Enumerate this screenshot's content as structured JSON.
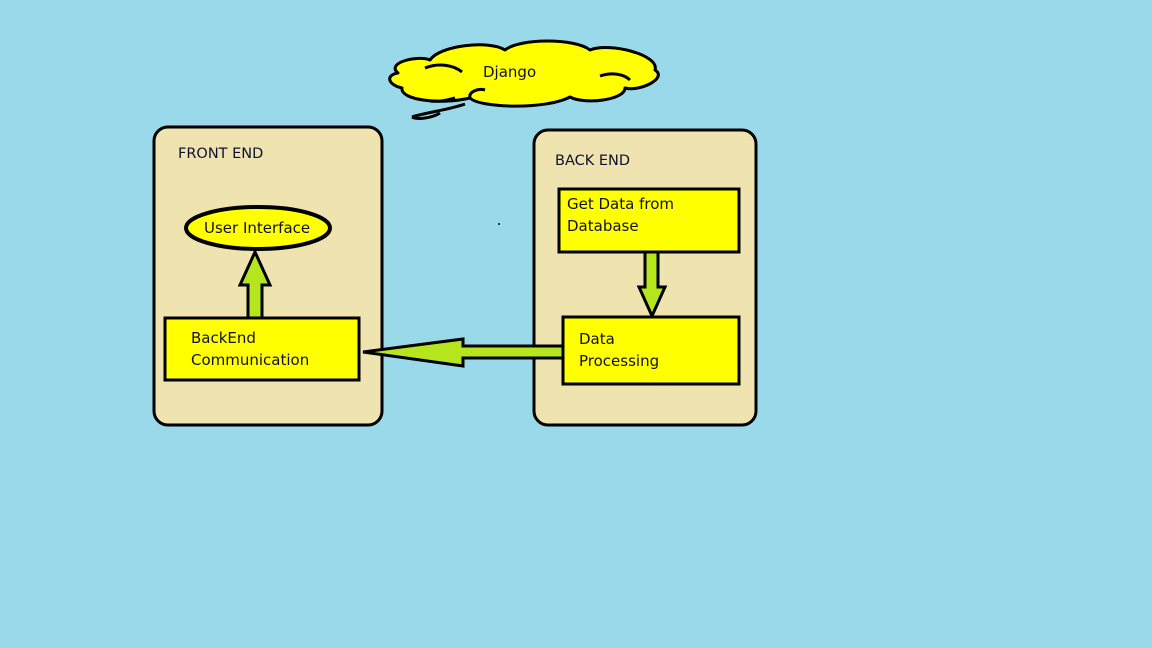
{
  "cloud": {
    "label": "Django"
  },
  "front_end": {
    "title": "FRONT END",
    "user_interface": "User Interface",
    "backend_comm_line1": "BackEnd",
    "backend_comm_line2": "Communication"
  },
  "back_end": {
    "title": "BACK END",
    "get_data_line1": "Get Data from",
    "get_data_line2": "Database",
    "processing_line1": "Data",
    "processing_line2": "Processing"
  },
  "colors": {
    "background": "#99d9ea",
    "panel": "#efe4b0",
    "box": "#ffff00",
    "arrow": "#b5e61d",
    "outline": "#000000"
  }
}
